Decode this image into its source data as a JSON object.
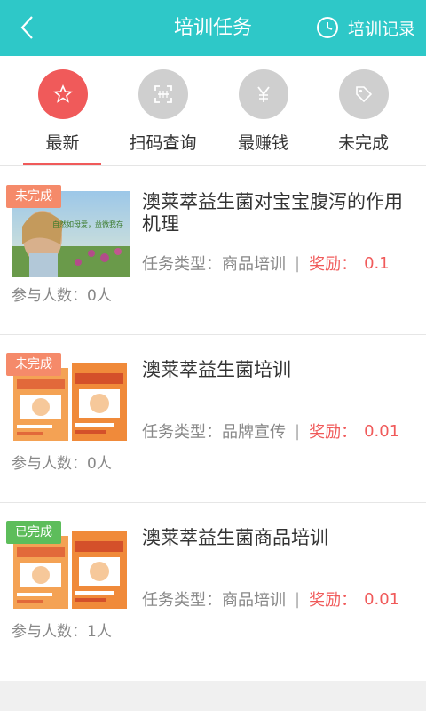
{
  "header": {
    "title": "培训任务",
    "history_label": "培训记录",
    "back_icon": "chevron-left-icon",
    "history_icon": "clock-icon"
  },
  "tabs": [
    {
      "label": "最新",
      "icon": "star-icon",
      "active": true
    },
    {
      "label": "扫码查询",
      "icon": "scan-icon",
      "active": false
    },
    {
      "label": "最赚钱",
      "icon": "yen-icon",
      "active": false
    },
    {
      "label": "未完成",
      "icon": "tag-icon",
      "active": false
    }
  ],
  "colors": {
    "header_bg": "#2ec8c8",
    "accent": "#f05a5a",
    "badge_pending": "#f58a6a",
    "badge_done": "#5dbd5b"
  },
  "items": [
    {
      "title": "澳莱萃益生菌对宝宝腹泻的作用机理",
      "type_label": "任务类型：商品培训",
      "reward_label": "奖励：",
      "reward": "0.1",
      "participants": "参与人数：0人",
      "status": "未完成",
      "image_caption": "自然如母爱，益微我存"
    },
    {
      "title": "澳莱萃益生菌培训",
      "type_label": "任务类型：品牌宣传",
      "reward_label": "奖励：",
      "reward": "0.01",
      "participants": "参与人数：0人",
      "status": "未完成"
    },
    {
      "title": "澳莱萃益生菌商品培训",
      "type_label": "任务类型：商品培训",
      "reward_label": "奖励：",
      "reward": "0.01",
      "participants": "参与人数：1人",
      "status": "已完成"
    }
  ]
}
